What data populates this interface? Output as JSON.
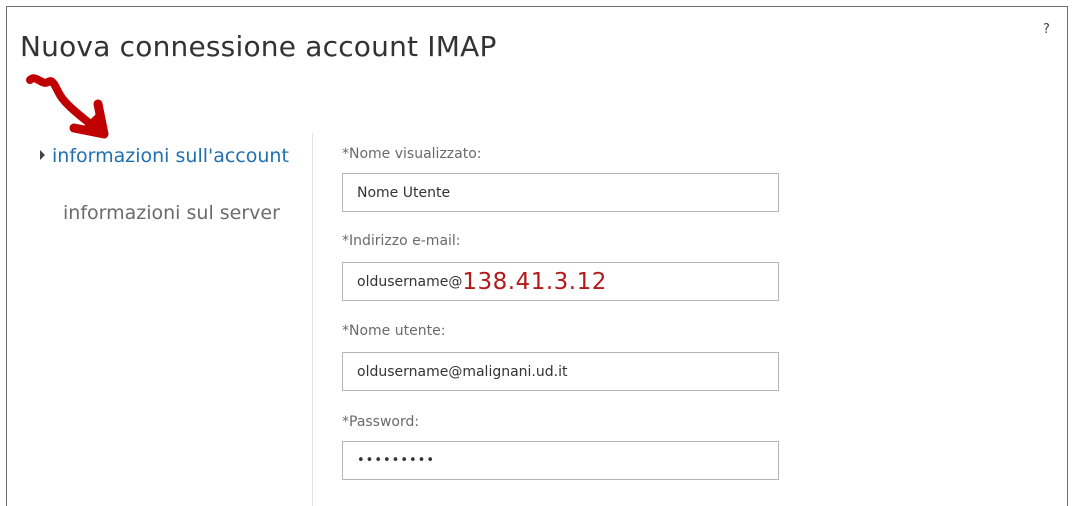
{
  "dialog": {
    "title": "Nuova connessione account IMAP",
    "help_label": "?"
  },
  "nav": {
    "items": [
      {
        "label": "informazioni sull'account",
        "active": true
      },
      {
        "label": "informazioni sul server",
        "active": false
      }
    ]
  },
  "form": {
    "display_name": {
      "label": "*Nome visualizzato:",
      "value": "Nome Utente"
    },
    "email": {
      "label": "*Indirizzo e-mail:",
      "value_local": "oldusername@",
      "value_domain": "138.41.3.12"
    },
    "username": {
      "label": "*Nome utente:",
      "value": "oldusername@malignani.ud.it"
    },
    "password": {
      "label": "*Password:",
      "value": "•••••••••"
    }
  },
  "colors": {
    "active_nav": "#1f6fb2",
    "annotation_red": "#b31a1a",
    "arrow_red": "#c00000"
  }
}
